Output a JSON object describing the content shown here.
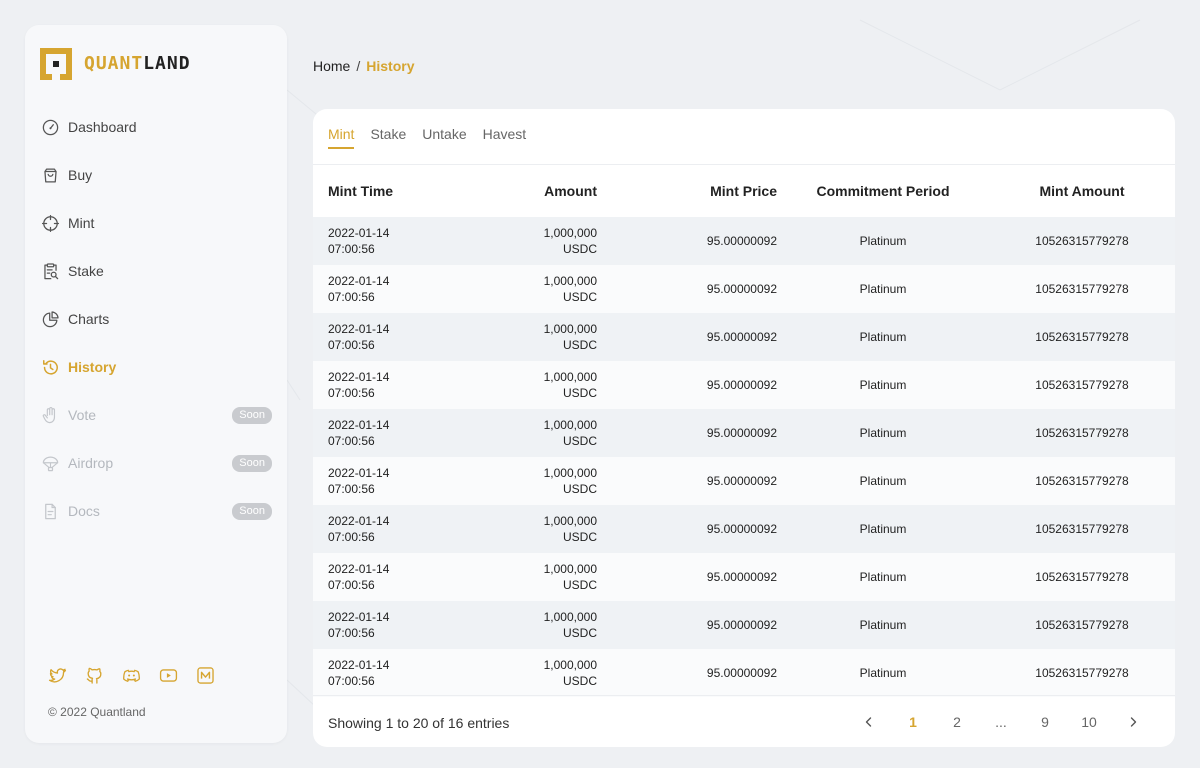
{
  "brand": {
    "name_part1": "QUANT",
    "name_part2": "LAND",
    "accent": "#d6a530"
  },
  "sidebar": {
    "items": [
      {
        "label": "Dashboard",
        "icon": "speedometer-icon"
      },
      {
        "label": "Buy",
        "icon": "shopping-bag-icon"
      },
      {
        "label": "Mint",
        "icon": "crosshair-icon"
      },
      {
        "label": "Stake",
        "icon": "clipboard-search-icon"
      },
      {
        "label": "Charts",
        "icon": "pie-chart-icon"
      },
      {
        "label": "History",
        "icon": "history-icon",
        "active": true
      },
      {
        "label": "Vote",
        "icon": "hand-icon",
        "badge": "Soon"
      },
      {
        "label": "Airdrop",
        "icon": "parachute-icon",
        "badge": "Soon"
      },
      {
        "label": "Docs",
        "icon": "document-icon",
        "badge": "Soon"
      }
    ],
    "socials": [
      "twitter-icon",
      "github-icon",
      "discord-icon",
      "youtube-icon",
      "medium-icon"
    ],
    "copyright": "© 2022 Quantland"
  },
  "breadcrumb": {
    "home": "Home",
    "sep": "/",
    "current": "History"
  },
  "tabs": [
    "Mint",
    "Stake",
    "Untake",
    "Havest"
  ],
  "table": {
    "headers": [
      "Mint Time",
      "Amount",
      "Mint Price",
      "Commitment Period",
      "Mint Amount"
    ],
    "rows": [
      {
        "date": "2022-01-14",
        "time": "07:00:56",
        "amount": "1,000,000",
        "unit": "USDC",
        "price": "95.00000092",
        "period": "Platinum",
        "mint_amount": "10526315779278"
      },
      {
        "date": "2022-01-14",
        "time": "07:00:56",
        "amount": "1,000,000",
        "unit": "USDC",
        "price": "95.00000092",
        "period": "Platinum",
        "mint_amount": "10526315779278"
      },
      {
        "date": "2022-01-14",
        "time": "07:00:56",
        "amount": "1,000,000",
        "unit": "USDC",
        "price": "95.00000092",
        "period": "Platinum",
        "mint_amount": "10526315779278"
      },
      {
        "date": "2022-01-14",
        "time": "07:00:56",
        "amount": "1,000,000",
        "unit": "USDC",
        "price": "95.00000092",
        "period": "Platinum",
        "mint_amount": "10526315779278"
      },
      {
        "date": "2022-01-14",
        "time": "07:00:56",
        "amount": "1,000,000",
        "unit": "USDC",
        "price": "95.00000092",
        "period": "Platinum",
        "mint_amount": "10526315779278"
      },
      {
        "date": "2022-01-14",
        "time": "07:00:56",
        "amount": "1,000,000",
        "unit": "USDC",
        "price": "95.00000092",
        "period": "Platinum",
        "mint_amount": "10526315779278"
      },
      {
        "date": "2022-01-14",
        "time": "07:00:56",
        "amount": "1,000,000",
        "unit": "USDC",
        "price": "95.00000092",
        "period": "Platinum",
        "mint_amount": "10526315779278"
      },
      {
        "date": "2022-01-14",
        "time": "07:00:56",
        "amount": "1,000,000",
        "unit": "USDC",
        "price": "95.00000092",
        "period": "Platinum",
        "mint_amount": "10526315779278"
      },
      {
        "date": "2022-01-14",
        "time": "07:00:56",
        "amount": "1,000,000",
        "unit": "USDC",
        "price": "95.00000092",
        "period": "Platinum",
        "mint_amount": "10526315779278"
      },
      {
        "date": "2022-01-14",
        "time": "07:00:56",
        "amount": "1,000,000",
        "unit": "USDC",
        "price": "95.00000092",
        "period": "Platinum",
        "mint_amount": "10526315779278"
      }
    ]
  },
  "pagination": {
    "summary": "Showing 1 to 20 of 16 entries",
    "pages": [
      "1",
      "2",
      "...",
      "9",
      "10"
    ],
    "current": "1",
    "prev_icon": "chevron-left-icon",
    "next_icon": "chevron-right-icon"
  }
}
